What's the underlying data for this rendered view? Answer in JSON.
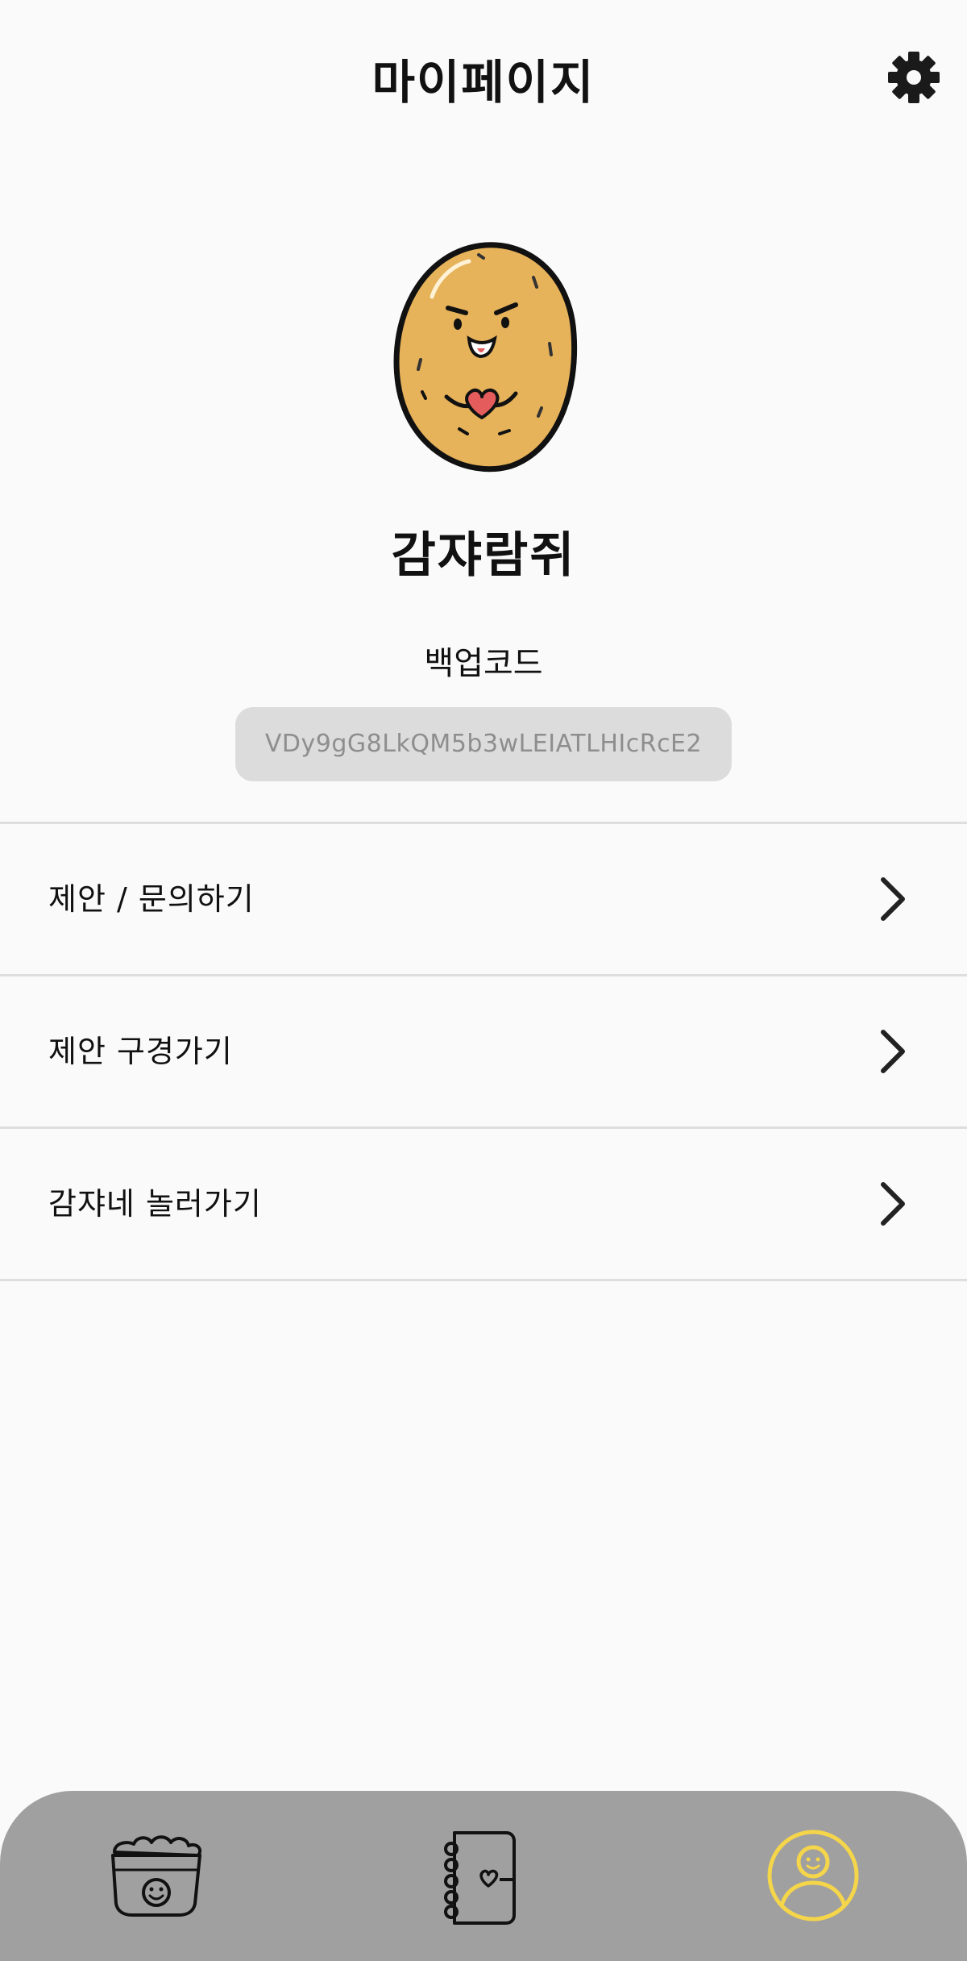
{
  "header": {
    "title": "마이페이지",
    "settings_icon": "gear-icon"
  },
  "profile": {
    "avatar_icon": "potato-character-icon",
    "nickname": "감쟈람쥐",
    "backup_label": "백업코드",
    "backup_code": "VDy9gG8LkQM5b3wLEIATLHIcRcE2"
  },
  "menu": {
    "items": [
      {
        "label": "제안 / 문의하기",
        "icon": "chevron-right-icon"
      },
      {
        "label": "제안 구경가기",
        "icon": "chevron-right-icon"
      },
      {
        "label": "감쟈네 놀러가기",
        "icon": "chevron-right-icon"
      }
    ]
  },
  "bottom_nav": {
    "items": [
      {
        "icon": "potato-basket-icon",
        "active": false
      },
      {
        "icon": "notebook-icon",
        "active": false
      },
      {
        "icon": "user-profile-icon",
        "active": true
      }
    ]
  },
  "colors": {
    "background": "#fafafa",
    "code_box": "#dcdcdc",
    "code_text": "#8e8e8e",
    "divider": "#dedede",
    "nav_bar": "#a0a0a0",
    "active_accent": "#f5d54a",
    "potato_fill": "#e6b25a"
  }
}
